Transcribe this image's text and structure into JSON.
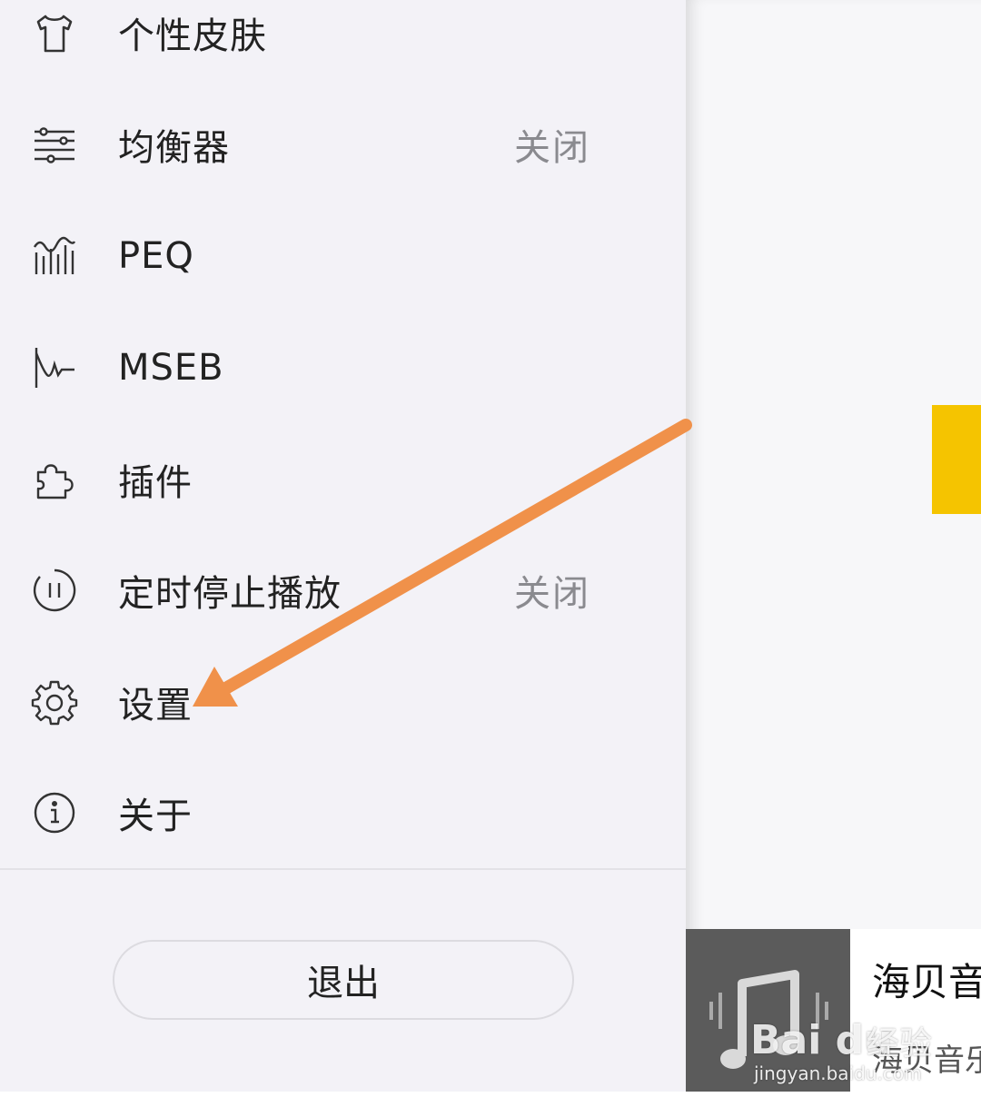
{
  "menu": {
    "items": [
      {
        "label": "个性皮肤",
        "value": "",
        "icon": "tshirt-icon"
      },
      {
        "label": "均衡器",
        "value": "关闭",
        "icon": "sliders-icon"
      },
      {
        "label": "PEQ",
        "value": "",
        "icon": "peq-graph-icon"
      },
      {
        "label": "MSEB",
        "value": "",
        "icon": "waveform-icon"
      },
      {
        "label": "插件",
        "value": "",
        "icon": "puzzle-icon"
      },
      {
        "label": "定时停止播放",
        "value": "关闭",
        "icon": "timer-pause-icon"
      },
      {
        "label": "设置",
        "value": "",
        "icon": "gear-icon"
      },
      {
        "label": "关于",
        "value": "",
        "icon": "info-icon"
      }
    ]
  },
  "exit_label": "退出",
  "player": {
    "title": "海贝音",
    "subtitle": "海贝音乐",
    "art_icon": "music-note-icon"
  },
  "watermark": {
    "logo": "Bai du",
    "cn": "经验",
    "url": "jingyan.baidu.com"
  },
  "colors": {
    "accent_arrow": "#f0914a",
    "yellow_card": "#f5c400",
    "value_grey": "#8a8a8f"
  }
}
